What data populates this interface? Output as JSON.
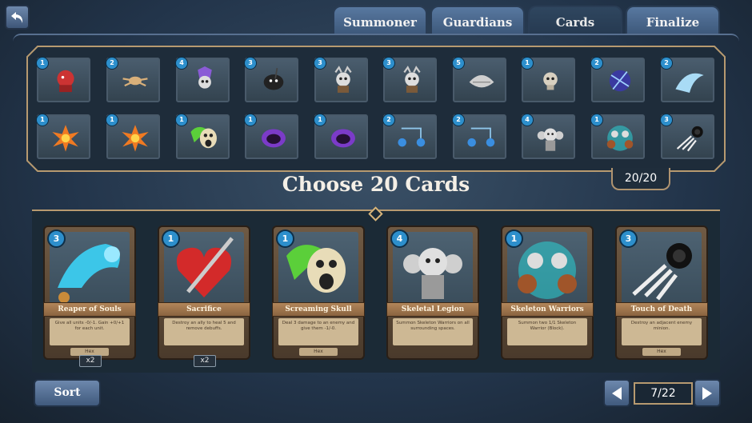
{
  "nav": {
    "back_icon": "back-arrow-icon",
    "tabs": [
      {
        "label": "Summoner",
        "active": false
      },
      {
        "label": "Guardians",
        "active": false
      },
      {
        "label": "Cards",
        "active": true
      },
      {
        "label": "Finalize",
        "active": false
      }
    ]
  },
  "deck": {
    "count": "20/20",
    "row1": [
      {
        "cost": "1",
        "art": "red-demon-icon"
      },
      {
        "cost": "2",
        "art": "bone-spider-icon"
      },
      {
        "cost": "4",
        "art": "purple-lich-icon"
      },
      {
        "cost": "3",
        "art": "shadow-reaper-icon"
      },
      {
        "cost": "3",
        "art": "skeleton-warrior-icon"
      },
      {
        "cost": "3",
        "art": "skeleton-warrior-icon"
      },
      {
        "cost": "5",
        "art": "bone-dragon-icon"
      },
      {
        "cost": "1",
        "art": "small-skull-icon"
      },
      {
        "cost": "2",
        "art": "blue-vortex-icon"
      },
      {
        "cost": "2",
        "art": "ice-wave-icon"
      }
    ],
    "row2": [
      {
        "cost": "1",
        "art": "fire-blast-icon"
      },
      {
        "cost": "1",
        "art": "fire-blast-icon"
      },
      {
        "cost": "1",
        "art": "screaming-skull-icon"
      },
      {
        "cost": "1",
        "art": "purple-orb-icon"
      },
      {
        "cost": "1",
        "art": "purple-orb-icon"
      },
      {
        "cost": "2",
        "art": "blue-flask-icon"
      },
      {
        "cost": "2",
        "art": "blue-flask-icon"
      },
      {
        "cost": "4",
        "art": "skeletal-legion-icon"
      },
      {
        "cost": "1",
        "art": "skeleton-warriors-icon"
      },
      {
        "cost": "3",
        "art": "bone-hand-icon"
      }
    ]
  },
  "title": "Choose 20 Cards",
  "collection": {
    "cards": [
      {
        "name": "Reaper of Souls",
        "cost": "3",
        "desc": "Give all units -0/-1. Gain +0/+1 for each unit.",
        "type": "Hex",
        "qty": "x2",
        "art": "blue-spirit-icon"
      },
      {
        "name": "Sacrifice",
        "cost": "1",
        "desc": "Destroy an ally to heal 5 and remove debuffs.",
        "type": "",
        "qty": "x2",
        "art": "pierced-heart-icon"
      },
      {
        "name": "Screaming Skull",
        "cost": "1",
        "desc": "Deal 3 damage to an enemy and give them -1/-0.",
        "type": "Hex",
        "qty": "",
        "art": "screaming-skull-icon"
      },
      {
        "name": "Skeletal Legion",
        "cost": "4",
        "desc": "Summon Skeleton Warriors on all surrounding spaces.",
        "type": "",
        "qty": "",
        "art": "skeletal-legion-icon"
      },
      {
        "name": "Skeleton Warriors",
        "cost": "1",
        "desc": "Summon two 1/1 Skeleton Warrior (Block).",
        "type": "",
        "qty": "",
        "art": "skeleton-warriors-icon"
      },
      {
        "name": "Touch of Death",
        "cost": "3",
        "desc": "Destroy an adjacent enemy minion.",
        "type": "Hex",
        "qty": "",
        "art": "bone-hand-icon"
      }
    ]
  },
  "controls": {
    "sort_label": "Sort",
    "page": "7/22",
    "prev_icon": "prev-arrow-icon",
    "next_icon": "next-arrow-icon"
  },
  "colors": {
    "accent": "#b79a70",
    "cost_blue": "#2d8fcc",
    "button": "#5a76a0"
  }
}
